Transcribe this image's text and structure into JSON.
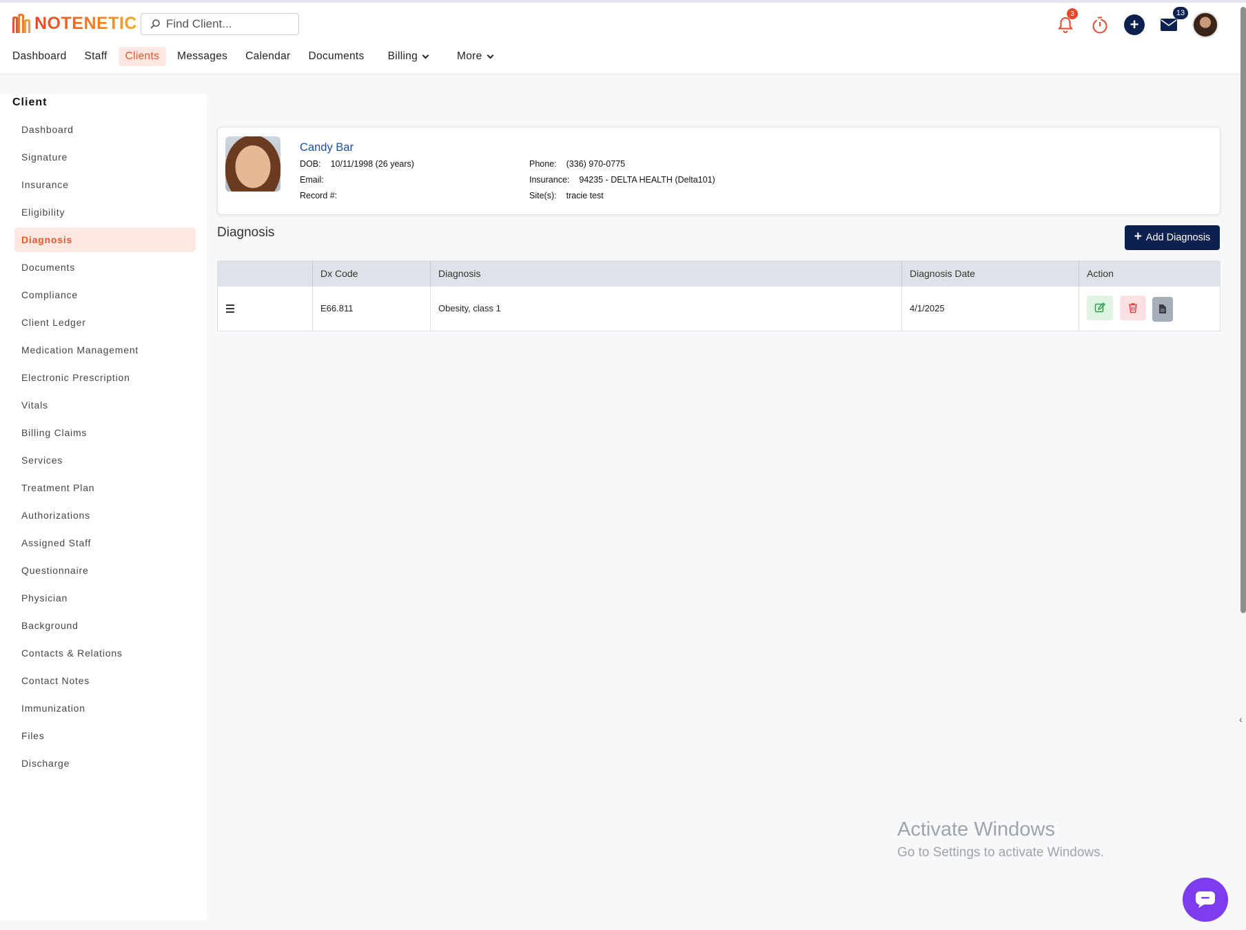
{
  "header": {
    "logo_text": "NOTENETIC",
    "search_placeholder": "Find Client...",
    "notifications_count": "3",
    "messages_count": "13",
    "nav": [
      {
        "label": "Dashboard"
      },
      {
        "label": "Staff"
      },
      {
        "label": "Clients",
        "active": true
      },
      {
        "label": "Messages"
      },
      {
        "label": "Calendar"
      },
      {
        "label": "Documents"
      },
      {
        "label": "Billing",
        "dropdown": true
      },
      {
        "label": "More",
        "dropdown": true
      }
    ]
  },
  "sidebar": {
    "title": "Client",
    "items": [
      {
        "label": "Dashboard"
      },
      {
        "label": "Signature"
      },
      {
        "label": "Insurance"
      },
      {
        "label": "Eligibility"
      },
      {
        "label": "Diagnosis",
        "active": true
      },
      {
        "label": "Documents"
      },
      {
        "label": "Compliance"
      },
      {
        "label": "Client Ledger"
      },
      {
        "label": "Medication Management"
      },
      {
        "label": "Electronic Prescription"
      },
      {
        "label": "Vitals"
      },
      {
        "label": "Billing Claims"
      },
      {
        "label": "Services"
      },
      {
        "label": "Treatment Plan"
      },
      {
        "label": "Authorizations"
      },
      {
        "label": "Assigned Staff"
      },
      {
        "label": "Questionnaire"
      },
      {
        "label": "Physician"
      },
      {
        "label": "Background"
      },
      {
        "label": "Contacts & Relations"
      },
      {
        "label": "Contact Notes"
      },
      {
        "label": "Immunization"
      },
      {
        "label": "Files"
      },
      {
        "label": "Discharge"
      }
    ]
  },
  "client": {
    "name": "Candy Bar",
    "dob_label": "DOB:",
    "dob_value": "10/11/1998 (26 years)",
    "email_label": "Email:",
    "email_value": "",
    "record_label": "Record #:",
    "record_value": "",
    "phone_label": "Phone:",
    "phone_value": "(336) 970-0775",
    "insurance_label": "Insurance:",
    "insurance_value": "94235 - DELTA HEALTH (Delta101)",
    "sites_label": "Site(s):",
    "sites_value": "tracie test"
  },
  "diagnosis": {
    "title": "Diagnosis",
    "add_button": "Add Diagnosis",
    "columns": [
      "",
      "Dx Code",
      "Diagnosis",
      "Diagnosis Date",
      "Action"
    ],
    "rows": [
      {
        "code": "E66.811",
        "diagnosis": "Obesity, class 1",
        "date": "4/1/2025"
      }
    ]
  },
  "watermark": {
    "line1": "Activate Windows",
    "line2": "Go to Settings to activate Windows."
  },
  "colors": {
    "brand_orange": "#e8562a",
    "navy": "#0c2150",
    "chat_purple": "#7d3cf0",
    "link_blue": "#1a4fa0"
  }
}
